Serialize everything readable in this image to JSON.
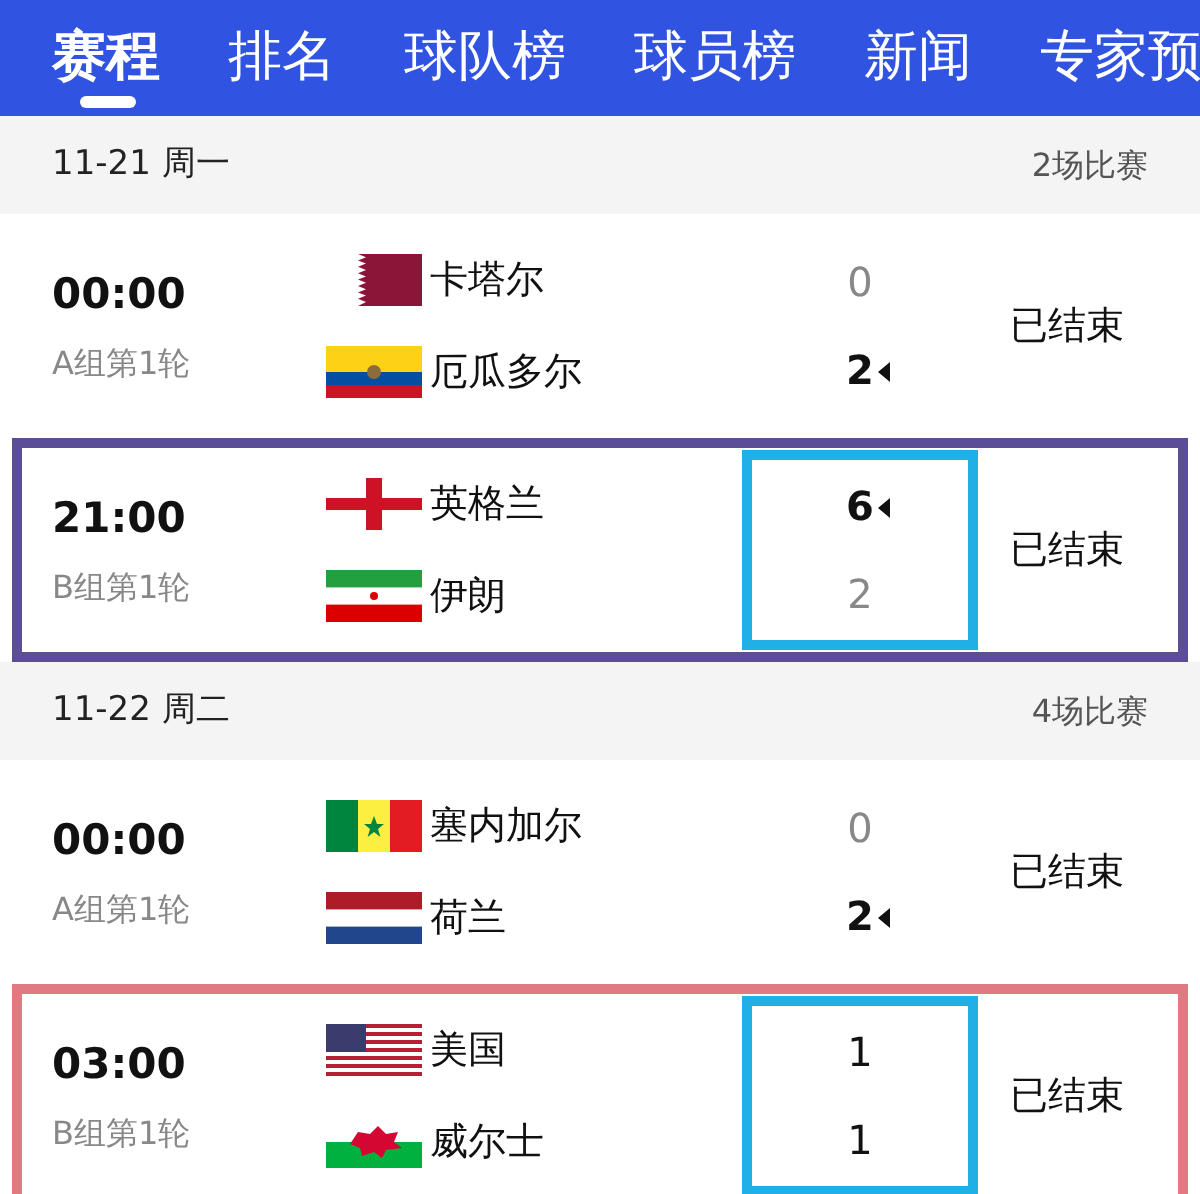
{
  "tabs": [
    {
      "label": "赛程",
      "selected": true
    },
    {
      "label": "排名",
      "selected": false
    },
    {
      "label": "球队榜",
      "selected": false
    },
    {
      "label": "球员榜",
      "selected": false
    },
    {
      "label": "新闻",
      "selected": false
    },
    {
      "label": "专家预",
      "selected": false
    }
  ],
  "days": [
    {
      "date": "11-21 周一",
      "count": "2场比赛",
      "matches": [
        {
          "time": "00:00",
          "round": "A组第1轮",
          "status": "已结束",
          "score_marked": false,
          "teams": [
            {
              "kind": "qatar",
              "name": "卡塔尔",
              "score": "0",
              "winner": false,
              "dimmed": true
            },
            {
              "kind": "ecuador",
              "name": "厄瓜多尔",
              "score": "2",
              "winner": true,
              "dimmed": false
            }
          ]
        },
        {
          "time": "21:00",
          "round": "B组第1轮",
          "status": "已结束",
          "color": "#5b4e96",
          "score_marked": true,
          "teams": [
            {
              "kind": "england",
              "name": "英格兰",
              "score": "6",
              "winner": true,
              "dimmed": false
            },
            {
              "kind": "iran",
              "name": "伊朗",
              "score": "2",
              "winner": false,
              "dimmed": true
            }
          ]
        }
      ]
    },
    {
      "date": "11-22 周二",
      "count": "4场比赛",
      "matches": [
        {
          "time": "00:00",
          "round": "A组第1轮",
          "status": "已结束",
          "score_marked": false,
          "teams": [
            {
              "kind": "senegal",
              "name": "塞内加尔",
              "score": "0",
              "winner": false,
              "dimmed": true
            },
            {
              "kind": "netherlands",
              "name": "荷兰",
              "score": "2",
              "winner": true,
              "dimmed": false
            }
          ]
        },
        {
          "time": "03:00",
          "round": "B组第1轮",
          "status": "已结束",
          "color": "#e07a80",
          "score_marked": true,
          "teams": [
            {
              "kind": "usa",
              "name": "美国",
              "score": "1",
              "winner": false,
              "dimmed": false
            },
            {
              "kind": "wales",
              "name": "威尔士",
              "score": "1",
              "winner": false,
              "dimmed": false
            }
          ]
        }
      ]
    }
  ]
}
